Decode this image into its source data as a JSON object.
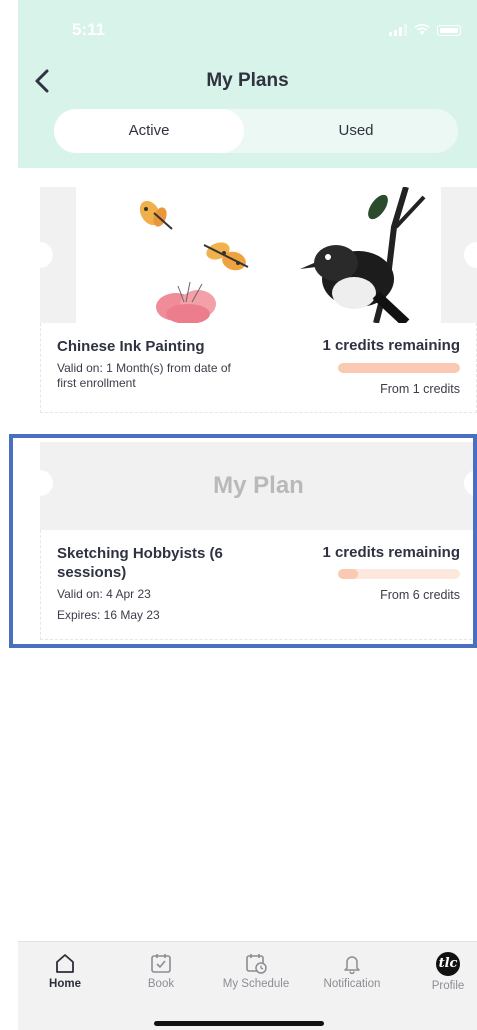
{
  "status_bar": {
    "time": "5:11"
  },
  "header": {
    "title": "My Plans"
  },
  "tabs": [
    {
      "label": "Active",
      "selected": true
    },
    {
      "label": "Used",
      "selected": false
    }
  ],
  "plans": [
    {
      "name": "Chinese Ink Painting",
      "valid_line1": "Valid on: 1 Month(s) from date of",
      "valid_line2": "first enrollment",
      "credits": "1 credits remaining",
      "from": "From 1 credits",
      "progress": 1.0,
      "image": "ink-painting-butterflies-magpie"
    },
    {
      "placeholder": "My Plan",
      "name_line1": "Sketching Hobbyists (6",
      "name_line2": "sessions)",
      "valid": "Valid on: 4 Apr 23",
      "expires": "Expires: 16 May 23",
      "credits": "1 credits remaining",
      "from": "From 6 credits",
      "progress": 0.167
    }
  ],
  "tabbar": [
    {
      "label": "Home",
      "icon": "home-icon",
      "active": true
    },
    {
      "label": "Book",
      "icon": "calendar-check-icon",
      "active": false
    },
    {
      "label": "My Schedule",
      "icon": "calendar-clock-icon",
      "active": false
    },
    {
      "label": "Notification",
      "icon": "bell-icon",
      "active": false
    },
    {
      "label": "Profile",
      "icon": "avatar",
      "active": false,
      "avatar_text": "tlc"
    }
  ],
  "colors": {
    "header_bg": "#d7f3ea",
    "progress_fill": "#f9c9b2",
    "progress_track": "#fde8de",
    "highlight": "#4a6fc0"
  }
}
